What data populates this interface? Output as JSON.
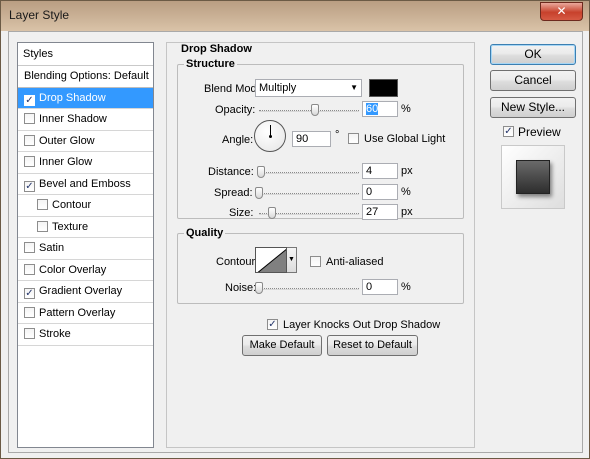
{
  "window": {
    "title": "Layer Style",
    "close_glyph": "✕"
  },
  "styles_panel": {
    "header": "Styles",
    "items": [
      {
        "label": "Blending Options: Default",
        "checkbox": false,
        "checked": false,
        "selected": false,
        "indent": false
      },
      {
        "label": "Drop Shadow",
        "checkbox": true,
        "checked": true,
        "selected": true,
        "indent": false
      },
      {
        "label": "Inner Shadow",
        "checkbox": true,
        "checked": false,
        "selected": false,
        "indent": false
      },
      {
        "label": "Outer Glow",
        "checkbox": true,
        "checked": false,
        "selected": false,
        "indent": false
      },
      {
        "label": "Inner Glow",
        "checkbox": true,
        "checked": false,
        "selected": false,
        "indent": false
      },
      {
        "label": "Bevel and Emboss",
        "checkbox": true,
        "checked": true,
        "selected": false,
        "indent": false
      },
      {
        "label": "Contour",
        "checkbox": true,
        "checked": false,
        "selected": false,
        "indent": true
      },
      {
        "label": "Texture",
        "checkbox": true,
        "checked": false,
        "selected": false,
        "indent": true
      },
      {
        "label": "Satin",
        "checkbox": true,
        "checked": false,
        "selected": false,
        "indent": false
      },
      {
        "label": "Color Overlay",
        "checkbox": true,
        "checked": false,
        "selected": false,
        "indent": false
      },
      {
        "label": "Gradient Overlay",
        "checkbox": true,
        "checked": true,
        "selected": false,
        "indent": false
      },
      {
        "label": "Pattern Overlay",
        "checkbox": true,
        "checked": false,
        "selected": false,
        "indent": false
      },
      {
        "label": "Stroke",
        "checkbox": true,
        "checked": false,
        "selected": false,
        "indent": false
      }
    ]
  },
  "drop_shadow": {
    "title": "Drop Shadow",
    "structure": {
      "title": "Structure",
      "blend_mode_label": "Blend Mode:",
      "blend_mode_value": "Multiply",
      "shadow_color": "#000000",
      "opacity_label": "Opacity:",
      "opacity_value": "60",
      "opacity_unit": "%",
      "angle_label": "Angle:",
      "angle_value": "90",
      "angle_unit": "°",
      "use_global_light_label": "Use Global Light",
      "use_global_light_checked": false,
      "distance_label": "Distance:",
      "distance_value": "4",
      "distance_unit": "px",
      "spread_label": "Spread:",
      "spread_value": "0",
      "spread_unit": "%",
      "size_label": "Size:",
      "size_value": "27",
      "size_unit": "px"
    },
    "quality": {
      "title": "Quality",
      "contour_label": "Contour:",
      "anti_aliased_label": "Anti-aliased",
      "anti_aliased_checked": false,
      "noise_label": "Noise:",
      "noise_value": "0",
      "noise_unit": "%"
    },
    "layer_knocks_out_label": "Layer Knocks Out Drop Shadow",
    "layer_knocks_out_checked": true,
    "make_default_label": "Make Default",
    "reset_default_label": "Reset to Default"
  },
  "side_buttons": {
    "ok_label": "OK",
    "cancel_label": "Cancel",
    "new_style_label": "New Style...",
    "preview_label": "Preview",
    "preview_checked": true
  }
}
